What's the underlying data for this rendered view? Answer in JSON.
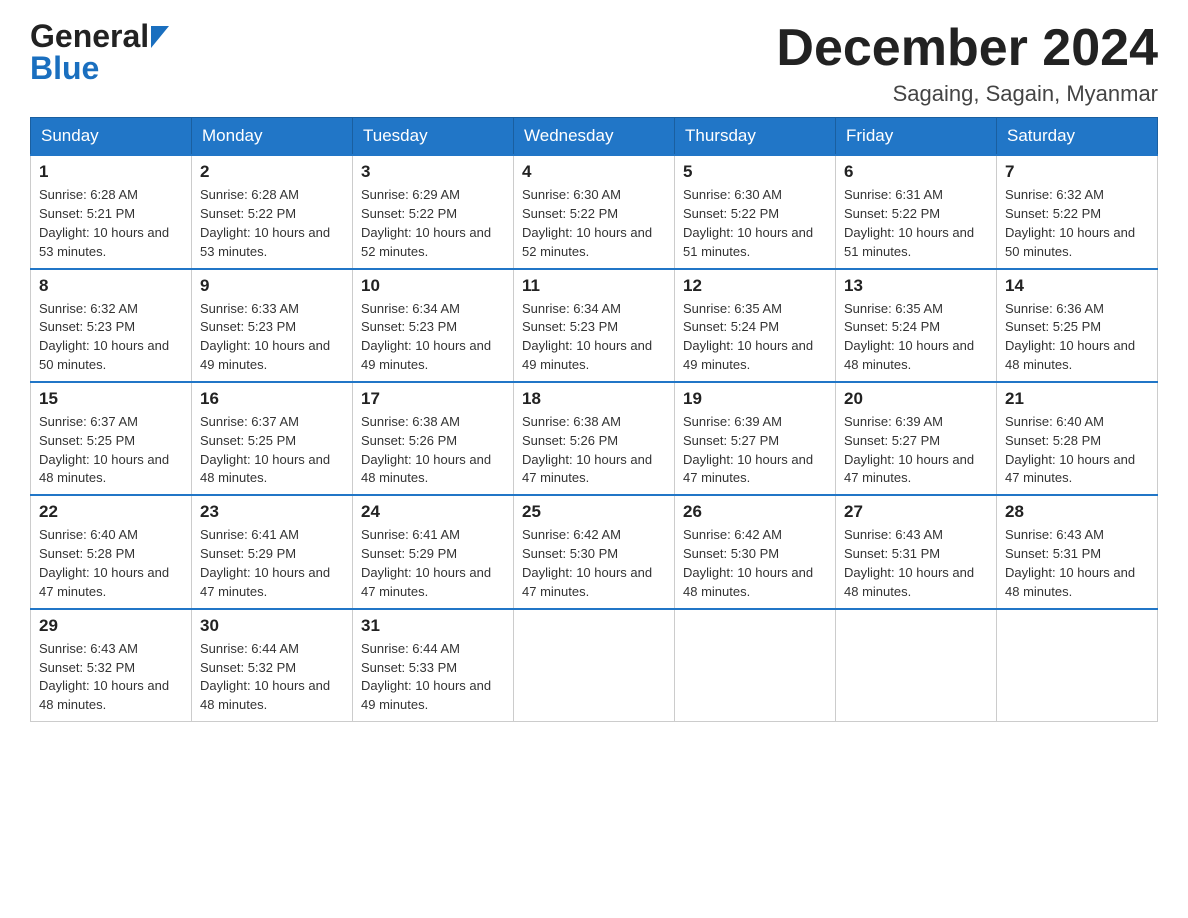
{
  "header": {
    "logo_general": "General",
    "logo_blue": "Blue",
    "month_title": "December 2024",
    "location": "Sagaing, Sagain, Myanmar"
  },
  "days_of_week": [
    "Sunday",
    "Monday",
    "Tuesday",
    "Wednesday",
    "Thursday",
    "Friday",
    "Saturday"
  ],
  "weeks": [
    [
      {
        "day": "1",
        "sunrise": "6:28 AM",
        "sunset": "5:21 PM",
        "daylight": "10 hours and 53 minutes."
      },
      {
        "day": "2",
        "sunrise": "6:28 AM",
        "sunset": "5:22 PM",
        "daylight": "10 hours and 53 minutes."
      },
      {
        "day": "3",
        "sunrise": "6:29 AM",
        "sunset": "5:22 PM",
        "daylight": "10 hours and 52 minutes."
      },
      {
        "day": "4",
        "sunrise": "6:30 AM",
        "sunset": "5:22 PM",
        "daylight": "10 hours and 52 minutes."
      },
      {
        "day": "5",
        "sunrise": "6:30 AM",
        "sunset": "5:22 PM",
        "daylight": "10 hours and 51 minutes."
      },
      {
        "day": "6",
        "sunrise": "6:31 AM",
        "sunset": "5:22 PM",
        "daylight": "10 hours and 51 minutes."
      },
      {
        "day": "7",
        "sunrise": "6:32 AM",
        "sunset": "5:22 PM",
        "daylight": "10 hours and 50 minutes."
      }
    ],
    [
      {
        "day": "8",
        "sunrise": "6:32 AM",
        "sunset": "5:23 PM",
        "daylight": "10 hours and 50 minutes."
      },
      {
        "day": "9",
        "sunrise": "6:33 AM",
        "sunset": "5:23 PM",
        "daylight": "10 hours and 49 minutes."
      },
      {
        "day": "10",
        "sunrise": "6:34 AM",
        "sunset": "5:23 PM",
        "daylight": "10 hours and 49 minutes."
      },
      {
        "day": "11",
        "sunrise": "6:34 AM",
        "sunset": "5:23 PM",
        "daylight": "10 hours and 49 minutes."
      },
      {
        "day": "12",
        "sunrise": "6:35 AM",
        "sunset": "5:24 PM",
        "daylight": "10 hours and 49 minutes."
      },
      {
        "day": "13",
        "sunrise": "6:35 AM",
        "sunset": "5:24 PM",
        "daylight": "10 hours and 48 minutes."
      },
      {
        "day": "14",
        "sunrise": "6:36 AM",
        "sunset": "5:25 PM",
        "daylight": "10 hours and 48 minutes."
      }
    ],
    [
      {
        "day": "15",
        "sunrise": "6:37 AM",
        "sunset": "5:25 PM",
        "daylight": "10 hours and 48 minutes."
      },
      {
        "day": "16",
        "sunrise": "6:37 AM",
        "sunset": "5:25 PM",
        "daylight": "10 hours and 48 minutes."
      },
      {
        "day": "17",
        "sunrise": "6:38 AM",
        "sunset": "5:26 PM",
        "daylight": "10 hours and 48 minutes."
      },
      {
        "day": "18",
        "sunrise": "6:38 AM",
        "sunset": "5:26 PM",
        "daylight": "10 hours and 47 minutes."
      },
      {
        "day": "19",
        "sunrise": "6:39 AM",
        "sunset": "5:27 PM",
        "daylight": "10 hours and 47 minutes."
      },
      {
        "day": "20",
        "sunrise": "6:39 AM",
        "sunset": "5:27 PM",
        "daylight": "10 hours and 47 minutes."
      },
      {
        "day": "21",
        "sunrise": "6:40 AM",
        "sunset": "5:28 PM",
        "daylight": "10 hours and 47 minutes."
      }
    ],
    [
      {
        "day": "22",
        "sunrise": "6:40 AM",
        "sunset": "5:28 PM",
        "daylight": "10 hours and 47 minutes."
      },
      {
        "day": "23",
        "sunrise": "6:41 AM",
        "sunset": "5:29 PM",
        "daylight": "10 hours and 47 minutes."
      },
      {
        "day": "24",
        "sunrise": "6:41 AM",
        "sunset": "5:29 PM",
        "daylight": "10 hours and 47 minutes."
      },
      {
        "day": "25",
        "sunrise": "6:42 AM",
        "sunset": "5:30 PM",
        "daylight": "10 hours and 47 minutes."
      },
      {
        "day": "26",
        "sunrise": "6:42 AM",
        "sunset": "5:30 PM",
        "daylight": "10 hours and 48 minutes."
      },
      {
        "day": "27",
        "sunrise": "6:43 AM",
        "sunset": "5:31 PM",
        "daylight": "10 hours and 48 minutes."
      },
      {
        "day": "28",
        "sunrise": "6:43 AM",
        "sunset": "5:31 PM",
        "daylight": "10 hours and 48 minutes."
      }
    ],
    [
      {
        "day": "29",
        "sunrise": "6:43 AM",
        "sunset": "5:32 PM",
        "daylight": "10 hours and 48 minutes."
      },
      {
        "day": "30",
        "sunrise": "6:44 AM",
        "sunset": "5:32 PM",
        "daylight": "10 hours and 48 minutes."
      },
      {
        "day": "31",
        "sunrise": "6:44 AM",
        "sunset": "5:33 PM",
        "daylight": "10 hours and 49 minutes."
      },
      null,
      null,
      null,
      null
    ]
  ]
}
